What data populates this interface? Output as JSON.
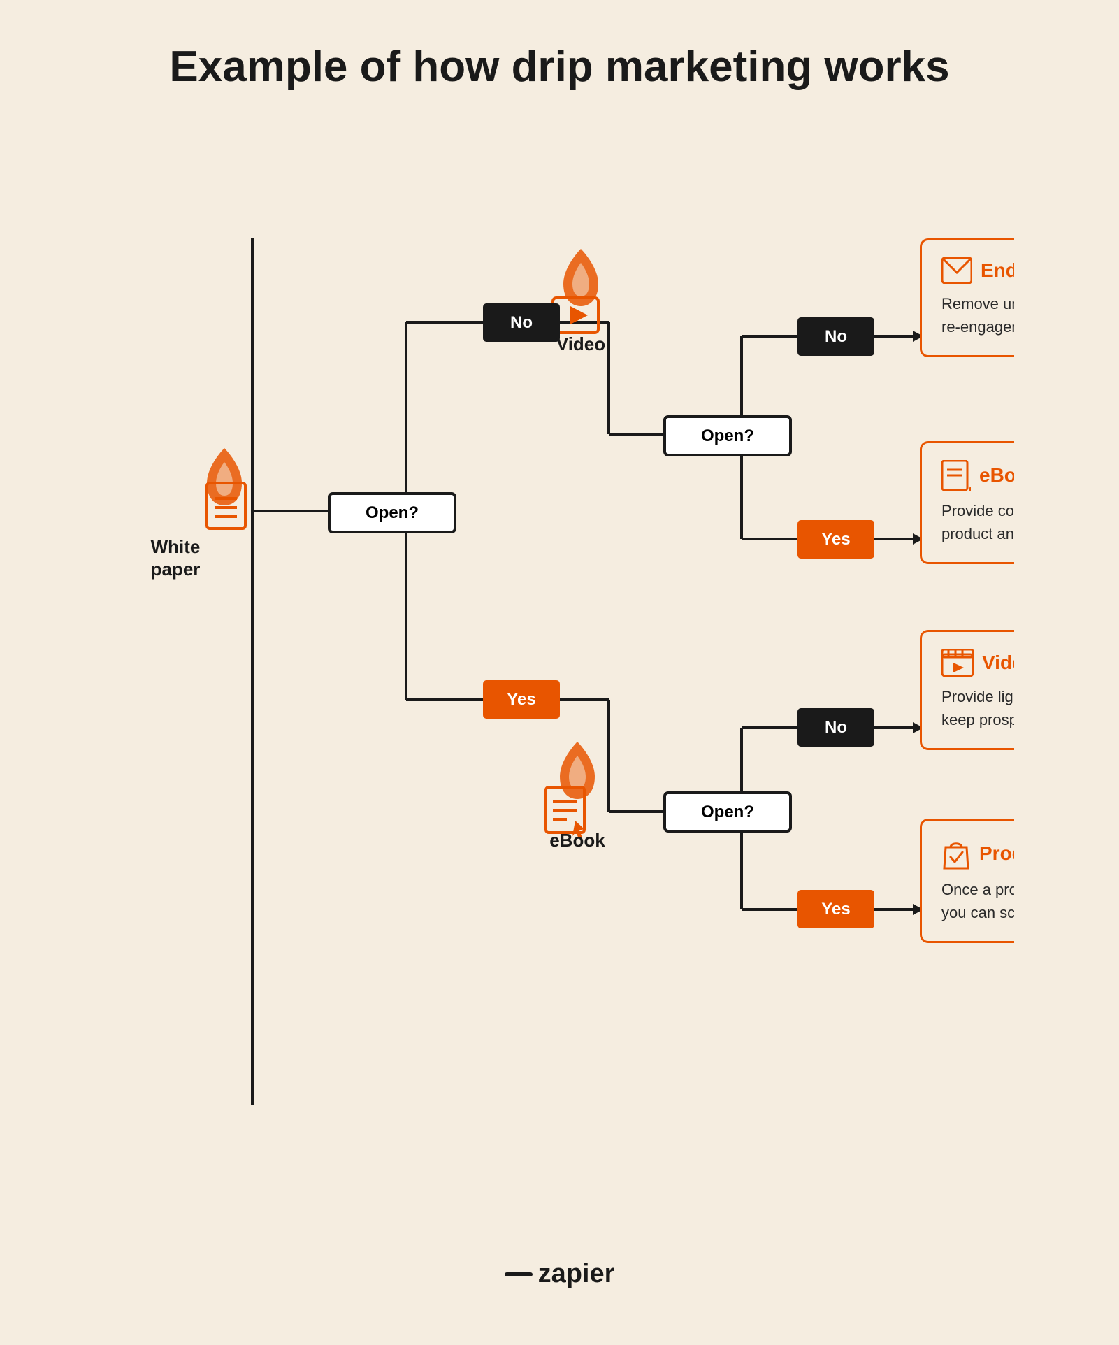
{
  "title": "Example of how drip marketing works",
  "nodes": {
    "white_paper_label": "White paper",
    "video_label": "Video",
    "ebook_label": "eBook",
    "open_label": "Open?",
    "no_label": "No",
    "yes_label": "Yes"
  },
  "cards": {
    "end_of_drip": {
      "title": "End of drip",
      "text": "Remove unengaged prospects or add them to re-engagement campaigns to reach out later."
    },
    "ebook": {
      "title": "eBook",
      "text": "Provide content for a deeper analysis of the product and its benefits."
    },
    "video_overview": {
      "title": "Video overview",
      "text": "Provide lighter, more engaging content to keep prospects interested in your product."
    },
    "product_demo": {
      "title": "Product demo",
      "text": "Once a prospect shows significant interest, you can schedule a personal call or meeting."
    }
  },
  "zapier": {
    "logo_text": "zapier"
  },
  "colors": {
    "orange": "#e85500",
    "dark": "#1a1a1a",
    "bg": "#f5ede0",
    "line": "#1a1a1a"
  }
}
